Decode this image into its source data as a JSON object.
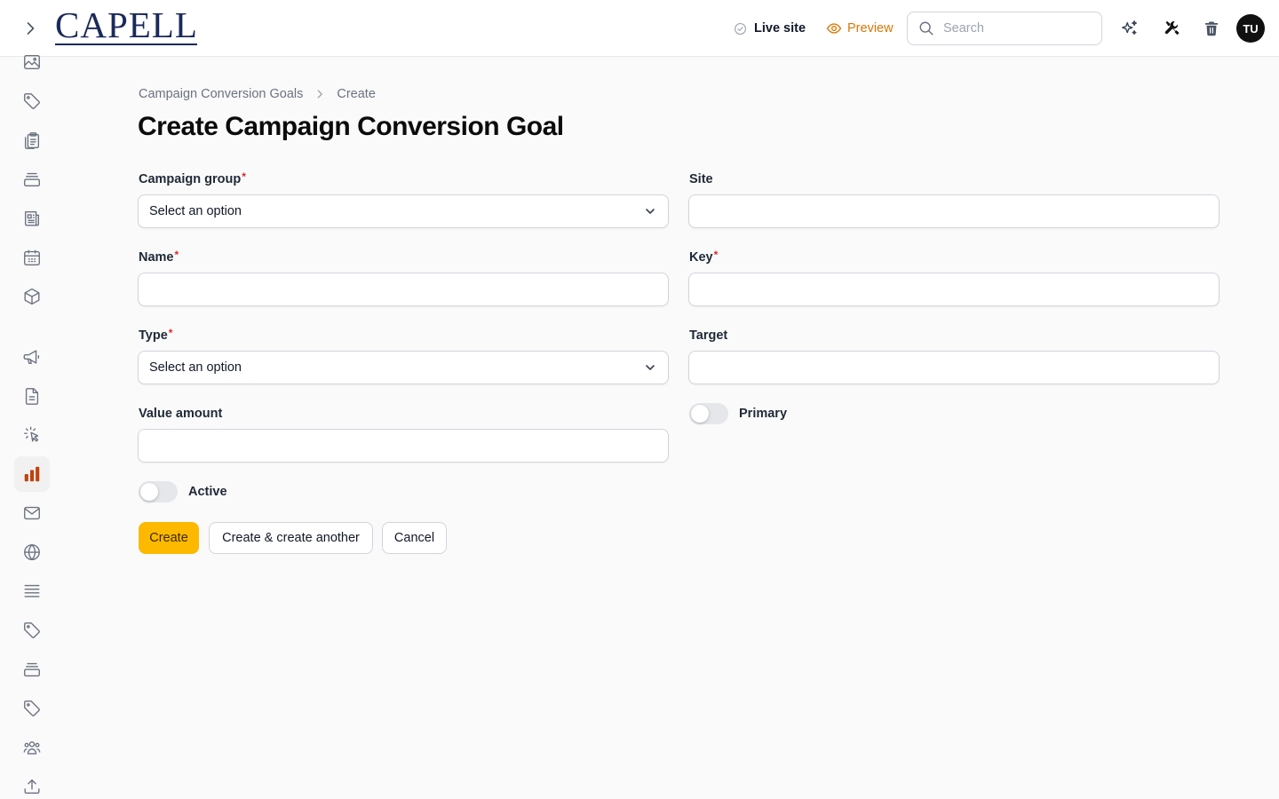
{
  "header": {
    "logo_text": "CAPELL",
    "live_site_label": "Live site",
    "preview_label": "Preview",
    "search_placeholder": "Search",
    "avatar_initials": "TU",
    "accent_color": "#d97706"
  },
  "sidebar": {
    "icons": [
      "image-icon",
      "tag-icon",
      "clipboard-icon",
      "archive-icon",
      "newspaper-icon",
      "calendar-icon",
      "cube-icon",
      "megaphone-icon",
      "document-icon",
      "cursor-click-icon",
      "bar-chart-icon",
      "envelope-icon",
      "globe-icon",
      "list-icon",
      "tag-icon",
      "archive-icon",
      "tag-icon",
      "user-group-icon",
      "upload-icon"
    ],
    "active_icon": "bar-chart-icon"
  },
  "breadcrumb": {
    "parent": "Campaign Conversion Goals",
    "current": "Create"
  },
  "page": {
    "title": "Create Campaign Conversion Goal"
  },
  "form": {
    "campaign_group": {
      "label": "Campaign group",
      "value": "Select an option",
      "required": true
    },
    "site": {
      "label": "Site",
      "value": ""
    },
    "name": {
      "label": "Name",
      "value": "",
      "required": true
    },
    "key": {
      "label": "Key",
      "value": "",
      "required": true
    },
    "type": {
      "label": "Type",
      "value": "Select an option",
      "required": true
    },
    "target": {
      "label": "Target",
      "value": ""
    },
    "value_amount": {
      "label": "Value amount",
      "value": ""
    },
    "primary": {
      "label": "Primary",
      "on": false
    },
    "active": {
      "label": "Active",
      "on": false
    }
  },
  "actions": {
    "create": "Create",
    "create_another": "Create & create another",
    "cancel": "Cancel"
  },
  "colors": {
    "primary_button": "#fcb900",
    "required_marker": "#dc2626"
  }
}
